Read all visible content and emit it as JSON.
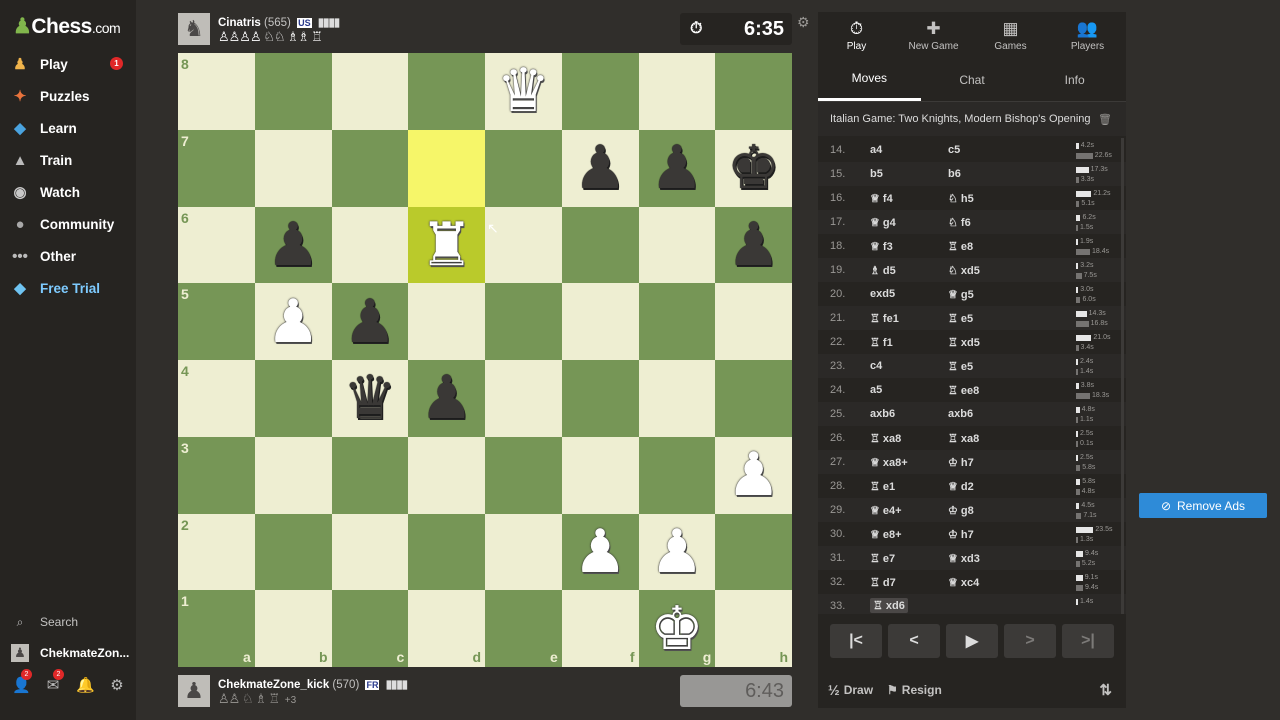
{
  "sidebar": {
    "logo": {
      "main": "Chess",
      "suffix": ".com"
    },
    "items": [
      {
        "label": "Play",
        "icon": "play-icon",
        "glyph": "♟",
        "badge": "1"
      },
      {
        "label": "Puzzles",
        "icon": "puzzle-icon",
        "glyph": "✦"
      },
      {
        "label": "Learn",
        "icon": "learn-icon",
        "glyph": "◆"
      },
      {
        "label": "Train",
        "icon": "train-icon",
        "glyph": "▲"
      },
      {
        "label": "Watch",
        "icon": "watch-icon",
        "glyph": "◉"
      },
      {
        "label": "Community",
        "icon": "community-icon",
        "glyph": "●"
      },
      {
        "label": "Other",
        "icon": "more-icon",
        "glyph": "•••"
      },
      {
        "label": "Free Trial",
        "icon": "diamond-icon",
        "glyph": "◆"
      }
    ],
    "search_label": "Search",
    "username": "ChekmateZon...",
    "bottom_badges": {
      "friends": "2",
      "messages": "2"
    }
  },
  "top_player": {
    "name": "Cinatris",
    "rating": "(565)",
    "flag": "US",
    "captured": "♙♙♙♙ ♘♘ ♗♗ ♖",
    "clock": "6:35"
  },
  "bottom_player": {
    "name": "ChekmateZone_kick",
    "rating": "(570)",
    "flag": "FR",
    "captured": "♙♙ ♘ ♗ ♖",
    "advantage": "+3",
    "clock": "6:43"
  },
  "board": {
    "files": [
      "a",
      "b",
      "c",
      "d",
      "e",
      "f",
      "g",
      "h"
    ],
    "ranks": [
      "8",
      "7",
      "6",
      "5",
      "4",
      "3",
      "2",
      "1"
    ],
    "highlight": [
      "d7",
      "d6"
    ],
    "pieces": {
      "e8": "wQ",
      "f7": "bP",
      "g7": "bP",
      "h7": "bK",
      "b6": "bP",
      "d6": "wR",
      "h6": "bP",
      "b5": "wP",
      "c5": "bP",
      "c4": "bQ",
      "d4": "bP",
      "h3": "wP",
      "f2": "wP",
      "g2": "wP",
      "g1": "wK"
    }
  },
  "panel": {
    "top_tabs": [
      {
        "label": "Play",
        "glyph": "⏱",
        "icon": "stopwatch-icon"
      },
      {
        "label": "New Game",
        "glyph": "✚",
        "icon": "new-game-icon"
      },
      {
        "label": "Games",
        "glyph": "▦",
        "icon": "games-icon"
      },
      {
        "label": "Players",
        "glyph": "👥",
        "icon": "players-icon"
      }
    ],
    "sub_tabs": [
      "Moves",
      "Chat",
      "Info"
    ],
    "opening": "Italian Game: Two Knights, Modern Bishop's Opening",
    "moves": [
      {
        "n": "14.",
        "w": "a4",
        "b": "c5",
        "wt": "4.2s",
        "bt": "22.6s",
        "wb": 0.1,
        "bb": 0.6
      },
      {
        "n": "15.",
        "w": "b5",
        "b": "b6",
        "wt": "17.3s",
        "bt": "3.3s",
        "wb": 0.45,
        "bb": 0.1
      },
      {
        "n": "16.",
        "w": "♕ f4",
        "b": "♘ h5",
        "wt": "21.2s",
        "bt": "5.1s",
        "wb": 0.55,
        "bb": 0.12
      },
      {
        "n": "17.",
        "w": "♕ g4",
        "b": "♘ f6",
        "wt": "6.2s",
        "bt": "1.5s",
        "wb": 0.16,
        "bb": 0.05
      },
      {
        "n": "18.",
        "w": "♕ f3",
        "b": "♖ e8",
        "wt": "1.9s",
        "bt": "18.4s",
        "wb": 0.05,
        "bb": 0.5
      },
      {
        "n": "19.",
        "w": "♗ d5",
        "b": "♘ xd5",
        "wt": "3.2s",
        "bt": "7.5s",
        "wb": 0.08,
        "bb": 0.2
      },
      {
        "n": "20.",
        "w": "exd5",
        "b": "♕ g5",
        "wt": "3.0s",
        "bt": "6.0s",
        "wb": 0.08,
        "bb": 0.16
      },
      {
        "n": "21.",
        "w": "♖ fe1",
        "b": "♖ e5",
        "wt": "14.3s",
        "bt": "16.8s",
        "wb": 0.38,
        "bb": 0.45
      },
      {
        "n": "22.",
        "w": "♖ f1",
        "b": "♖ xd5",
        "wt": "21.0s",
        "bt": "3.4s",
        "wb": 0.55,
        "bb": 0.09
      },
      {
        "n": "23.",
        "w": "c4",
        "b": "♖ e5",
        "wt": "2.4s",
        "bt": "1.4s",
        "wb": 0.06,
        "bb": 0.04
      },
      {
        "n": "24.",
        "w": "a5",
        "b": "♖ ee8",
        "wt": "3.8s",
        "bt": "18.3s",
        "wb": 0.1,
        "bb": 0.5
      },
      {
        "n": "25.",
        "w": "axb6",
        "b": "axb6",
        "wt": "4.8s",
        "bt": "1.1s",
        "wb": 0.13,
        "bb": 0.03
      },
      {
        "n": "26.",
        "w": "♖ xa8",
        "b": "♖ xa8",
        "wt": "2.5s",
        "bt": "0.1s",
        "wb": 0.07,
        "bb": 0.01
      },
      {
        "n": "27.",
        "w": "♕ xa8+",
        "b": "♔ h7",
        "wt": "2.5s",
        "bt": "5.8s",
        "wb": 0.07,
        "bb": 0.15
      },
      {
        "n": "28.",
        "w": "♖ e1",
        "b": "♕ d2",
        "wt": "5.8s",
        "bt": "4.8s",
        "wb": 0.15,
        "bb": 0.13
      },
      {
        "n": "29.",
        "w": "♕ e4+",
        "b": "♔ g8",
        "wt": "4.5s",
        "bt": "7.1s",
        "wb": 0.12,
        "bb": 0.19
      },
      {
        "n": "30.",
        "w": "♕ e8+",
        "b": "♔ h7",
        "wt": "23.5s",
        "bt": "1.3s",
        "wb": 0.62,
        "bb": 0.04
      },
      {
        "n": "31.",
        "w": "♖ e7",
        "b": "♕ xd3",
        "wt": "9.4s",
        "bt": "5.2s",
        "wb": 0.25,
        "bb": 0.14
      },
      {
        "n": "32.",
        "w": "♖ d7",
        "b": "♕ xc4",
        "wt": "9.1s",
        "bt": "9.4s",
        "wb": 0.24,
        "bb": 0.25
      },
      {
        "n": "33.",
        "w": "♖ xd6",
        "b": "",
        "wt": "1.4s",
        "bt": "",
        "wb": 0.04,
        "bb": 0
      }
    ],
    "controls": [
      "|<",
      "<",
      "▶",
      ">",
      ">|"
    ],
    "draw_label": "Draw",
    "resign_label": "Resign"
  },
  "ad": {
    "remove_ads_label": "Remove Ads"
  }
}
